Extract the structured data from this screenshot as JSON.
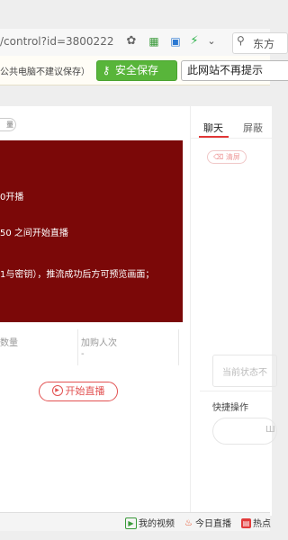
{
  "browser": {
    "url": "/control?id=3800222",
    "search_text": "东方",
    "colors": {
      "accent_green": "#58b53a"
    }
  },
  "password_bar": {
    "hint": "公共电脑不建议保存）",
    "save_label": "安全保存",
    "never_label": "此网站不再提示"
  },
  "left_card": {
    "tag": "量",
    "video_lines": [
      "0开播",
      "50 之间开始直播",
      "1与密钥），推流成功后方可预览画面；"
    ],
    "stats": {
      "left_label": "数量",
      "right_label": "加购人次",
      "right_value": "-"
    },
    "start_button": "开始直播",
    "colors": {
      "video_bg": "#7b0808",
      "accent_red": "#e25151"
    }
  },
  "chat_panel": {
    "tabs": [
      "聊天",
      "屏蔽"
    ],
    "clear_label": "清屏",
    "status_placeholder": "当前状态不",
    "quick_label": "快捷操作",
    "quick_input_text": "Ш"
  },
  "bottom_bar": {
    "items": [
      {
        "label": "我的视频",
        "icon": "video-icon"
      },
      {
        "label": "今日直播",
        "icon": "fire-icon"
      },
      {
        "label": "热点",
        "icon": "hot-icon"
      }
    ]
  }
}
